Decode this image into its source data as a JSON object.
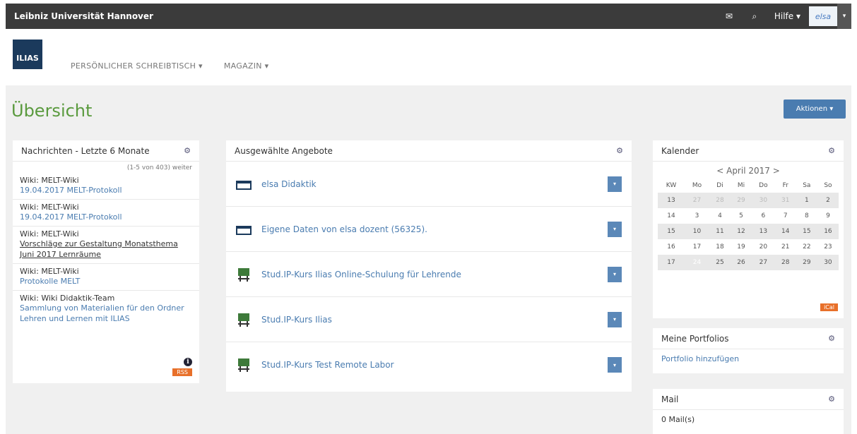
{
  "topbar": {
    "brand": "Leibniz Universität Hannover",
    "help": "Hilfe",
    "user": "elsa"
  },
  "header": {
    "logo": "ILIAS",
    "nav": [
      {
        "label": "PERSÖNLICHER SCHREIBTISCH ▾"
      },
      {
        "label": "MAGAZIN ▾"
      }
    ]
  },
  "page": {
    "title": "Übersicht",
    "actions": "Aktionen ▾"
  },
  "news": {
    "title": "Nachrichten - Letzte 6 Monate",
    "count": "(1-5 von 403) weiter",
    "items": [
      {
        "title": "Wiki: MELT-Wiki",
        "link": "19.04.2017 MELT-Protokoll"
      },
      {
        "title": "Wiki: MELT-Wiki",
        "link": "19.04.2017 MELT-Protokoll"
      },
      {
        "title": "Wiki: MELT-Wiki",
        "link": "Vorschläge zur Gestaltung Monatsthema Juni 2017 Lernräume"
      },
      {
        "title": "Wiki: MELT-Wiki",
        "link": "Protokolle MELT"
      },
      {
        "title": "Wiki: Wiki Didaktik-Team",
        "link": "Sammlung von Materialien für den Ordner Lehren und Lernen mit ILIAS"
      }
    ],
    "rss": "RSS"
  },
  "offers": {
    "title": "Ausgewählte Angebote",
    "items": [
      {
        "label": "elsa Didaktik"
      },
      {
        "label": "Eigene Daten von elsa dozent (56325)."
      },
      {
        "label": "Stud.IP-Kurs Ilias Online-Schulung für Lehrende"
      },
      {
        "label": "Stud.IP-Kurs Ilias"
      },
      {
        "label": "Stud.IP-Kurs Test Remote Labor"
      }
    ]
  },
  "calendar": {
    "title": "Kalender",
    "month": "< April 2017 >",
    "headers": [
      "KW",
      "Mo",
      "Di",
      "Mi",
      "Do",
      "Fr",
      "Sa",
      "So"
    ],
    "weeks": [
      [
        "13",
        "27",
        "28",
        "29",
        "30",
        "31",
        "1",
        "2"
      ],
      [
        "14",
        "3",
        "4",
        "5",
        "6",
        "7",
        "8",
        "9"
      ],
      [
        "15",
        "10",
        "11",
        "12",
        "13",
        "14",
        "15",
        "16"
      ],
      [
        "16",
        "17",
        "18",
        "19",
        "20",
        "21",
        "22",
        "23"
      ],
      [
        "17",
        "24",
        "25",
        "26",
        "27",
        "28",
        "29",
        "30"
      ]
    ],
    "ical": "iCal"
  },
  "portfolio": {
    "title": "Meine Portfolios",
    "link": "Portfolio hinzufügen"
  },
  "mail": {
    "title": "Mail",
    "text": "0 Mail(s)"
  }
}
